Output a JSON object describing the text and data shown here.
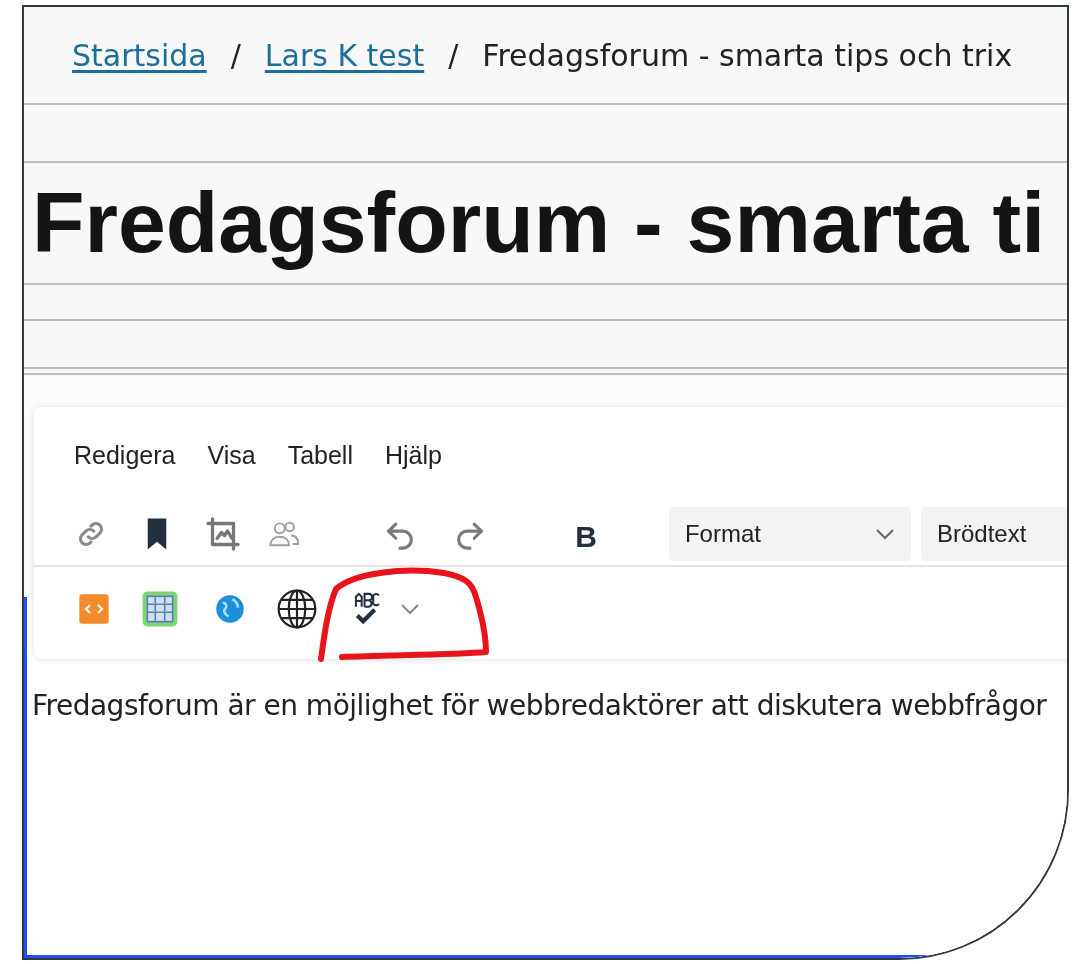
{
  "breadcrumb": [
    {
      "label": "Startsida",
      "link": true
    },
    {
      "label": "Lars K test",
      "link": true,
      "separator": "/"
    },
    {
      "label": "Fredagsforum - smarta tips och trix",
      "link": false,
      "separator": "/"
    }
  ],
  "page_title": "Fredagsforum - smarta ti",
  "editor": {
    "menu": [
      "Redigera",
      "Visa",
      "Tabell",
      "Hjälp"
    ],
    "bold_label": "B",
    "dropdowns": [
      "Format",
      "Brödtext"
    ],
    "body_text": "Fredagsforum är en möjlighet för webbredaktörer att diskutera webbfrågor"
  }
}
